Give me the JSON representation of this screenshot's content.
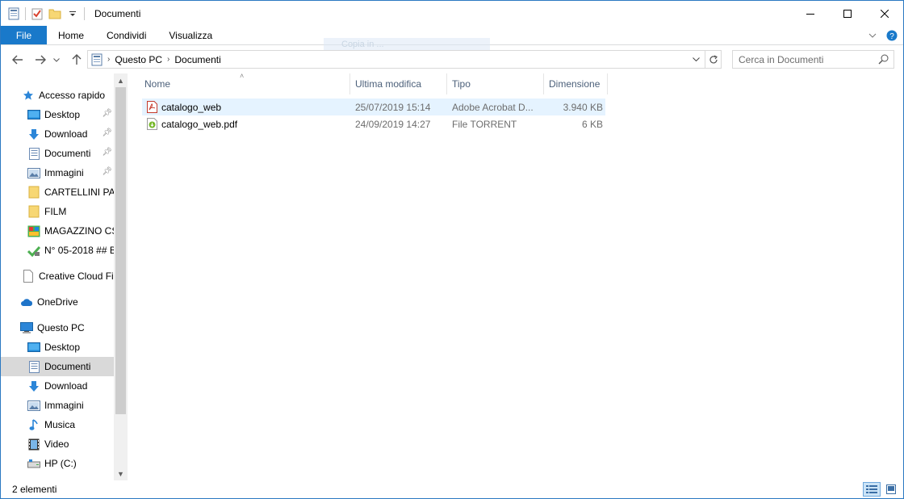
{
  "window": {
    "title": "Documenti",
    "controls": {
      "minimize": "minimize",
      "maximize": "maximize",
      "close": "close"
    }
  },
  "ribbon": {
    "tabs": [
      "File",
      "Home",
      "Condividi",
      "Visualizza"
    ]
  },
  "drag_ghost": "Copia in ...",
  "address": {
    "crumbs": [
      "Questo PC",
      "Documenti"
    ]
  },
  "search": {
    "placeholder": "Cerca in Documenti"
  },
  "nav": {
    "quick_access": {
      "label": "Accesso rapido",
      "items": [
        {
          "label": "Desktop",
          "pinned": true,
          "icon": "desktop-folder-icon"
        },
        {
          "label": "Download",
          "pinned": true,
          "icon": "download-arrow-icon"
        },
        {
          "label": "Documenti",
          "pinned": true,
          "icon": "documents-icon"
        },
        {
          "label": "Immagini",
          "pinned": true,
          "icon": "pictures-icon"
        },
        {
          "label": "CARTELLINI PAR",
          "pinned": false,
          "icon": "folder-icon"
        },
        {
          "label": "FILM",
          "pinned": false,
          "icon": "folder-icon"
        },
        {
          "label": "MAGAZZINO CS",
          "pinned": false,
          "icon": "app-folder-icon"
        },
        {
          "label": "N° 05-2018 ## B",
          "pinned": false,
          "icon": "network-folder-icon"
        }
      ]
    },
    "creative_cloud": "Creative Cloud Fil",
    "onedrive": "OneDrive",
    "this_pc": {
      "label": "Questo PC",
      "items": [
        {
          "label": "Desktop",
          "icon": "desktop-folder-icon"
        },
        {
          "label": "Documenti",
          "icon": "documents-icon",
          "selected": true
        },
        {
          "label": "Download",
          "icon": "download-arrow-icon"
        },
        {
          "label": "Immagini",
          "icon": "pictures-icon"
        },
        {
          "label": "Musica",
          "icon": "music-note-icon"
        },
        {
          "label": "Video",
          "icon": "video-film-icon"
        },
        {
          "label": "HP (C:)",
          "icon": "drive-icon"
        }
      ]
    }
  },
  "columns": {
    "name": "Nome",
    "modified": "Ultima modifica",
    "type": "Tipo",
    "size": "Dimensione"
  },
  "files": [
    {
      "name": "catalogo_web",
      "modified": "25/07/2019 15:14",
      "type": "Adobe Acrobat D...",
      "size": "3.940 KB",
      "icon": "pdf-icon"
    },
    {
      "name": "catalogo_web.pdf",
      "modified": "24/09/2019 14:27",
      "type": "File TORRENT",
      "size": "6 KB",
      "icon": "torrent-icon"
    }
  ],
  "status": {
    "count": "2 elementi"
  },
  "colors": {
    "accent": "#1979ca",
    "selection": "#d9d9d9",
    "hover": "#e5f3ff",
    "header_text": "#4c607a"
  }
}
